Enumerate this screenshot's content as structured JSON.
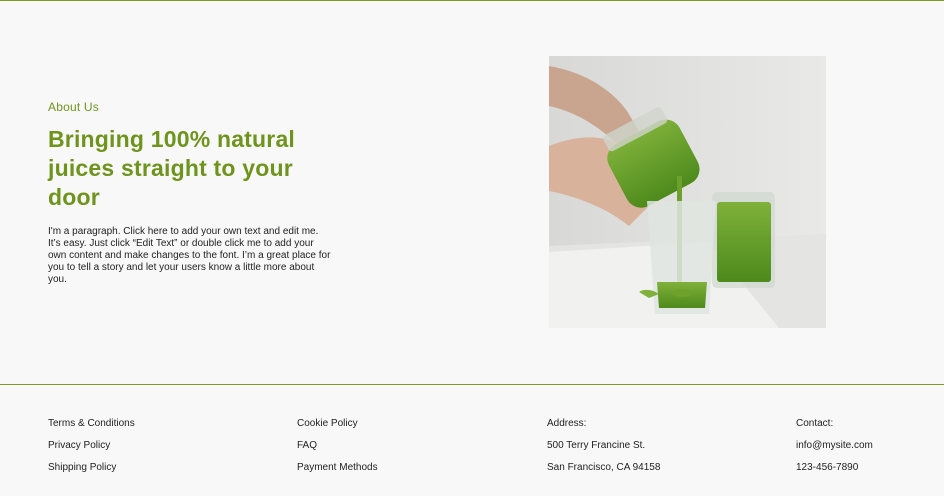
{
  "about": {
    "eyebrow": "About Us",
    "headline": "Bringing 100% natural juices straight to your door",
    "paragraph": "I'm a paragraph. Click here to add your own text and edit me. It’s easy. Just click “Edit Text” or double click me to add your own content and make changes to the font. I’m a great place for you to tell a story and let your users know a little more about you."
  },
  "footer": {
    "col1": [
      "Terms & Conditions",
      "Privacy Policy",
      "Shipping Policy"
    ],
    "col2": [
      "Cookie Policy",
      "FAQ",
      "Payment Methods"
    ],
    "address": [
      "Address:",
      "500 Terry Francine St.",
      "San Francisco, CA 94158"
    ],
    "contact": [
      "Contact:",
      "info@mysite.com",
      "123-456-7890"
    ]
  },
  "colors": {
    "accent": "#6f941d",
    "rule": "#7b9a22",
    "background": "#f8f8f8"
  }
}
